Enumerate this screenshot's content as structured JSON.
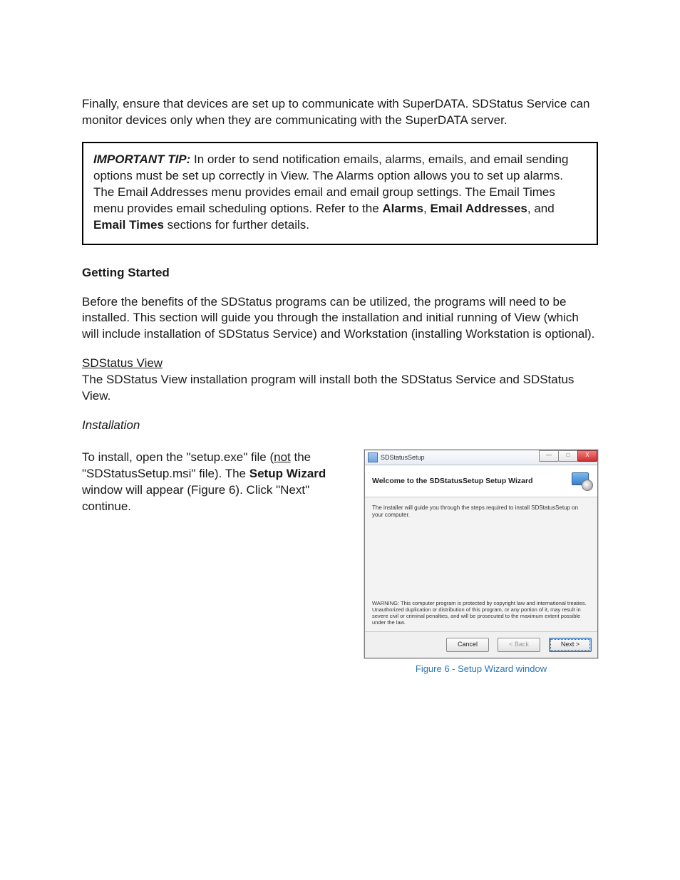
{
  "intro_paragraph": "Finally, ensure that devices are set up to communicate with SuperDATA. SDStatus Service can monitor devices only when they are communicating with the SuperDATA server.",
  "tip": {
    "label": "IMPORTANT TIP:",
    "body_before": " In order to send notification emails, alarms, emails, and email sending options must be set up correctly in View. The Alarms option allows you to set up alarms. The Email Addresses menu provides email and email group settings. The Email Times menu provides email scheduling options. Refer to the ",
    "bold1": "Alarms",
    "sep1": ", ",
    "bold2": "Email Addresses",
    "sep2": ", and ",
    "bold3": "Email Times",
    "body_after": " sections for further details."
  },
  "getting_started": {
    "heading": "Getting Started",
    "paragraph": "Before the benefits of the SDStatus programs can be utilized, the programs will need to be installed. This section will guide you through the installation and initial running of View (which will include installation of SDStatus Service) and Workstation (installing Workstation is optional)."
  },
  "sdstatus_view": {
    "heading": "SDStatus View",
    "paragraph": "The SDStatus View installation program will install both the SDStatus Service and SDStatus View."
  },
  "installation": {
    "heading": "Installation",
    "p_before": "To install, open the \"setup.exe\" file (",
    "p_underlined": "not",
    "p_mid": " the \"SDStatusSetup.msi\" file). The ",
    "p_bold": "Setup Wizard",
    "p_after": " window will appear (Figure 6). Click \"Next\" continue."
  },
  "dialog": {
    "title": "SDStatusSetup",
    "banner_title": "Welcome to the SDStatusSetup Setup Wizard",
    "intro_text": "The installer will guide you through the steps required to install SDStatusSetup on your computer.",
    "warning_text": "WARNING: This computer program is protected by copyright law and international treaties. Unauthorized duplication or distribution of this program, or any portion of it, may result in severe civil or criminal penalties, and will be prosecuted to the maximum extent possible under the law.",
    "btn_cancel": "Cancel",
    "btn_back": "< Back",
    "btn_next": "Next >",
    "ctrl_min": "—",
    "ctrl_max": "□",
    "ctrl_close": "X"
  },
  "caption": "Figure 6 - Setup Wizard window"
}
